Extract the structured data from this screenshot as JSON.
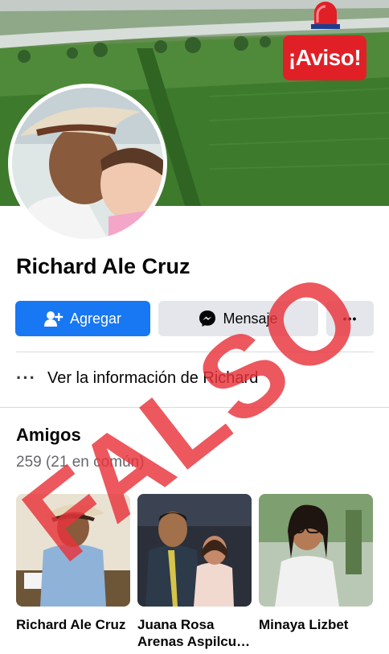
{
  "badge": {
    "text": "¡Aviso!",
    "color": "#e11f26"
  },
  "profile": {
    "name": "Richard Ale Cruz",
    "add_button_label": "Agregar",
    "message_button_label": "Mensaje",
    "more_button_label": "•••",
    "info_link": "Ver la información de Richard"
  },
  "friends": {
    "title": "Amigos",
    "count_text": "259 (21 en común)",
    "items": [
      {
        "name": "Richard Ale Cruz"
      },
      {
        "name": "Juana Rosa Arenas Aspilcu…"
      },
      {
        "name": "Minaya Lizbet"
      }
    ]
  },
  "stamp": {
    "text": "FALSO",
    "color": "#e8333a"
  },
  "colors": {
    "primary": "#1877f2",
    "secondary_button": "#e4e6eb",
    "muted_text": "#65676b"
  }
}
